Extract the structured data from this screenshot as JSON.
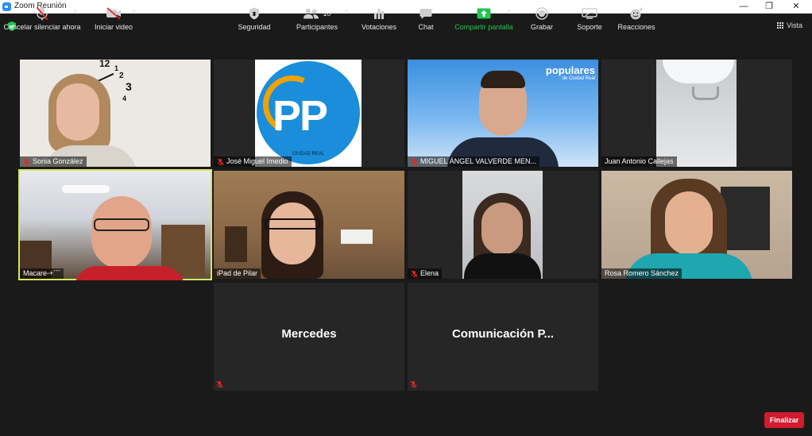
{
  "window": {
    "title": "Zoom Reunión",
    "minimize": "—",
    "restore": "❐",
    "close": "✕"
  },
  "view_button": {
    "label": "Vista"
  },
  "participants": [
    {
      "name": "Sonia González",
      "muted": true
    },
    {
      "name": "José Miguel Imedio",
      "muted": true,
      "logo_text": "CIUDAD REAL"
    },
    {
      "name": "MIGUEL ÁNGEL VALVERDE MEN...",
      "muted": true,
      "brand": "populares",
      "brand_sub": "de Ciudad Real"
    },
    {
      "name": "Juan Antonio Callejas",
      "muted": false
    },
    {
      "name": "Macare-+´´´",
      "muted": false,
      "active_speaker": true
    },
    {
      "name": "iPad de Pilar",
      "muted": false
    },
    {
      "name": "Elena",
      "muted": true
    },
    {
      "name": "Rosa Romero Sánchez",
      "muted": false
    },
    {
      "name": "Mercedes",
      "muted": true,
      "video_off": true
    },
    {
      "name": "Comunicación  P...",
      "muted": true,
      "video_off": true
    }
  ],
  "toolbar": {
    "mute_label": "Cancelar silenciar ahora",
    "video_label": "Iniciar video",
    "security_label": "Seguridad",
    "participants_label": "Participantes",
    "participants_count": "10",
    "polls_label": "Votaciones",
    "chat_label": "Chat",
    "share_label": "Compartir pantalla",
    "record_label": "Grabar",
    "support_label": "Soporte",
    "reactions_label": "Reacciones",
    "end_label": "Finalizar"
  },
  "colors": {
    "background": "#1a1a1a",
    "tile": "#262626",
    "active_border": "#d7e85c",
    "end_button": "#d21b2d",
    "share_green": "#23c552",
    "mute_red": "#e02828"
  }
}
